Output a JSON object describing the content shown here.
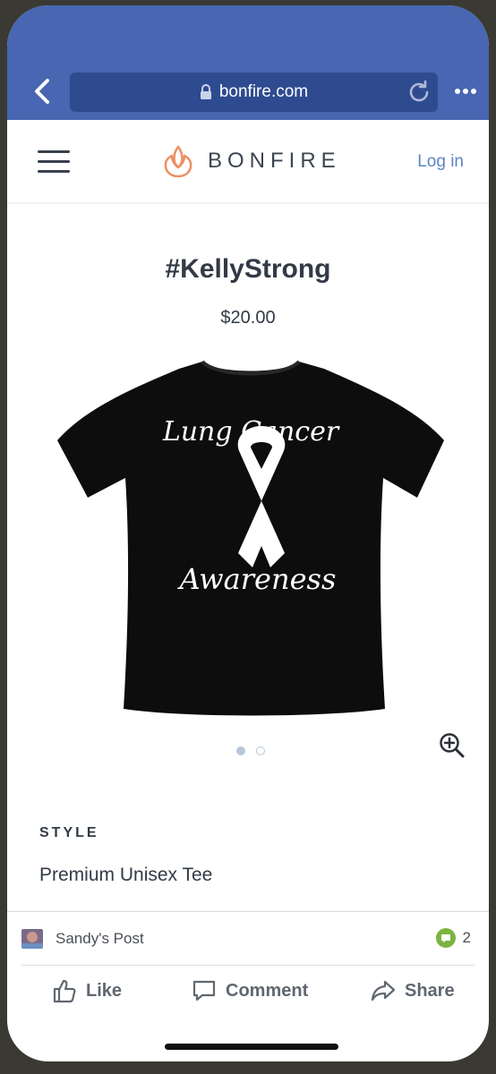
{
  "browser": {
    "url": "bonfire.com",
    "icons": {
      "back": "chevron-left-icon",
      "lock": "lock-icon",
      "reload": "reload-icon",
      "more": "more-dots-icon"
    },
    "colors": {
      "bar": "#4866b1",
      "field": "#2f4b90"
    }
  },
  "header": {
    "logo_text": "BONFIRE",
    "login_label": "Log in",
    "icons": {
      "menu": "hamburger-menu-icon",
      "logo": "bonfire-flame-icon"
    }
  },
  "product": {
    "title": "#KellyStrong",
    "price": "$20.00",
    "shirt_text_top": "Lung Cancer",
    "shirt_text_bottom": "Awareness",
    "carousel": {
      "total": 2,
      "active_index": 0
    },
    "style_label": "STYLE",
    "style_value": "Premium Unisex Tee",
    "icons": {
      "zoom": "zoom-in-icon",
      "ribbon": "awareness-ribbon-icon"
    }
  },
  "post_bar": {
    "post_name": "Sandy's Post",
    "comment_count": "2",
    "actions": [
      {
        "label": "Like",
        "icon": "thumbs-up-icon"
      },
      {
        "label": "Comment",
        "icon": "comment-icon"
      },
      {
        "label": "Share",
        "icon": "share-icon"
      }
    ],
    "colors": {
      "comment_badge": "#7bb441"
    }
  }
}
